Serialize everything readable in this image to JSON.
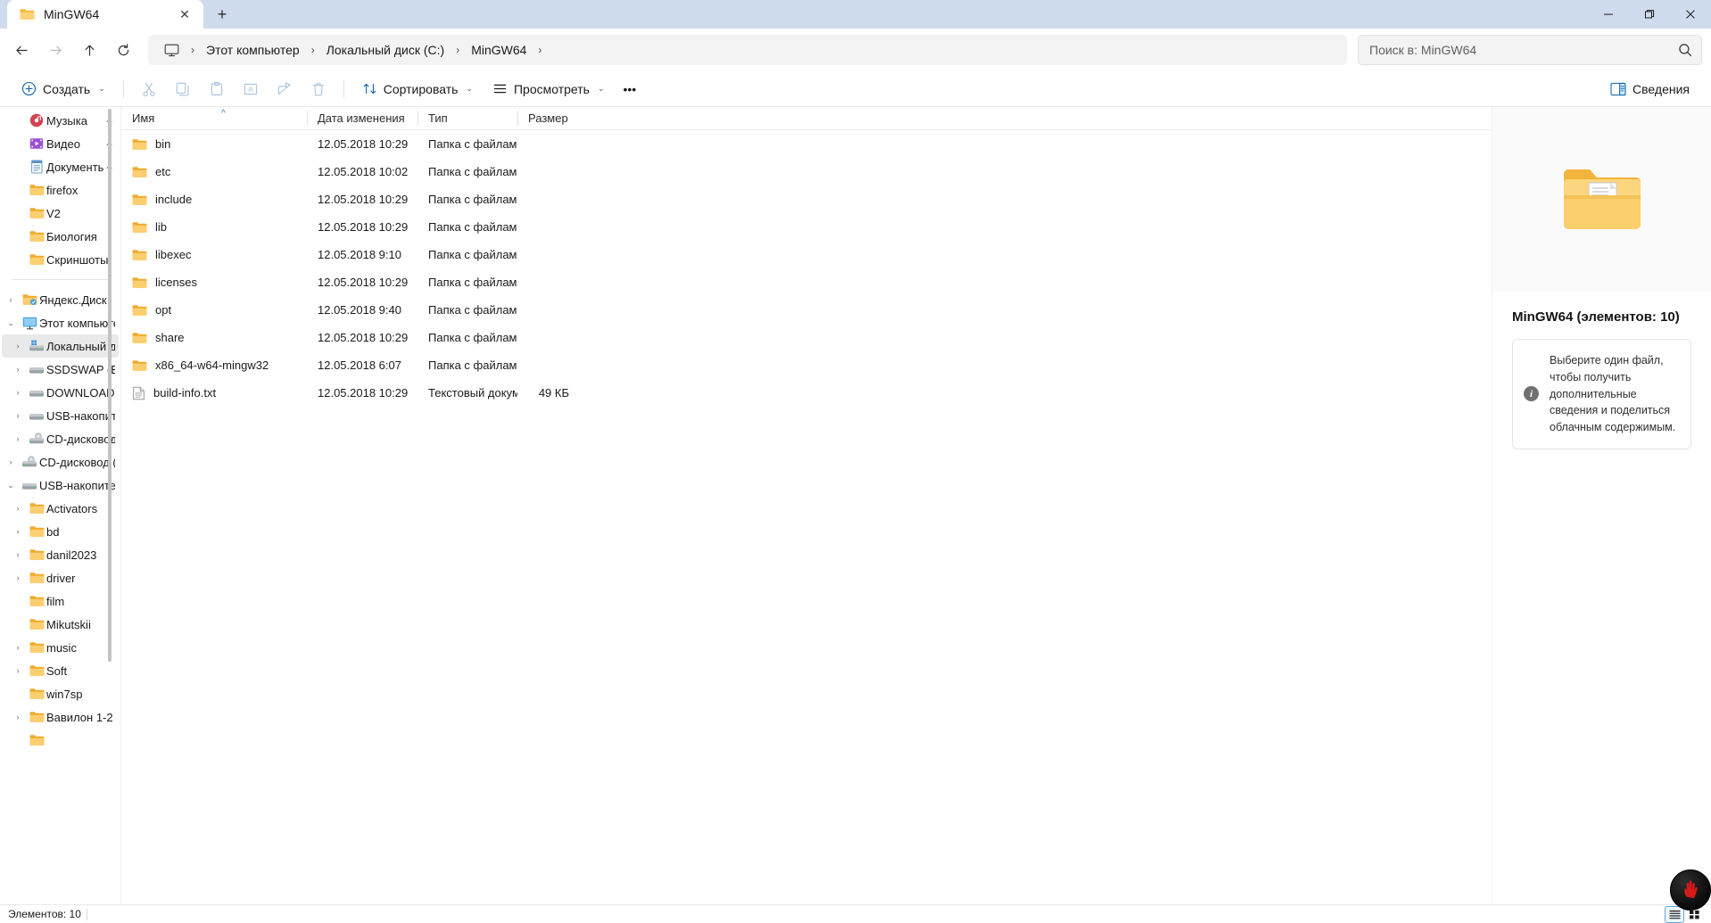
{
  "window": {
    "tab_title": "MinGW64",
    "tab_close_label": "✕",
    "new_tab_label": "+",
    "minimize_label": "—",
    "maximize_label": "❐",
    "close_label": "✕"
  },
  "nav": {
    "back_label": "←",
    "forward_label": "→",
    "up_label": "↑",
    "refresh_label": "⟳",
    "breadcrumbs": [
      {
        "label": "Этот компьютер"
      },
      {
        "label": "Локальный диск (C:)"
      },
      {
        "label": "MinGW64"
      }
    ],
    "separator": "›"
  },
  "search": {
    "placeholder": "Поиск в: MinGW64",
    "value": ""
  },
  "toolbar": {
    "new_label": "Создать",
    "cut_label": "",
    "copy_label": "",
    "paste_label": "",
    "rename_label": "",
    "share_label": "",
    "delete_label": "",
    "sort_label": "Сортировать",
    "view_label": "Просмотреть",
    "more_label": "•••",
    "details_label": "Сведения",
    "chevron": "⌄"
  },
  "sidebar": {
    "scroll_visible": true,
    "items": [
      {
        "label": "Музыка",
        "icon": "music-icon",
        "indent": 1,
        "twisty": "",
        "pinned": true
      },
      {
        "label": "Видео",
        "icon": "video-icon",
        "indent": 1,
        "twisty": "",
        "pinned": true
      },
      {
        "label": "Документы",
        "icon": "document-icon",
        "indent": 1,
        "twisty": "",
        "pinned": true
      },
      {
        "label": "firefox",
        "icon": "folder-icon",
        "indent": 1,
        "twisty": "",
        "pinned": false
      },
      {
        "label": "V2",
        "icon": "folder-icon",
        "indent": 1,
        "twisty": "",
        "pinned": false
      },
      {
        "label": "Биология",
        "icon": "folder-icon",
        "indent": 1,
        "twisty": "",
        "pinned": false
      },
      {
        "label": "Скриншоты",
        "icon": "folder-icon",
        "indent": 1,
        "twisty": "",
        "pinned": false
      },
      {
        "divider": true
      },
      {
        "label": "Яндекс.Диск",
        "icon": "yandex-disk-icon",
        "indent": 0,
        "twisty": "›",
        "pinned": false
      },
      {
        "label": "Этот компьютер",
        "icon": "computer-icon",
        "indent": 0,
        "twisty": "⌄",
        "pinned": false
      },
      {
        "label": "Локальный ди",
        "icon": "local-disk-icon",
        "indent": 1,
        "twisty": "›",
        "pinned": false,
        "selected": true
      },
      {
        "label": "SSDSWAP (E:)",
        "icon": "drive-icon",
        "indent": 1,
        "twisty": "›",
        "pinned": false
      },
      {
        "label": "DOWNLOADS",
        "icon": "drive-icon",
        "indent": 1,
        "twisty": "›",
        "pinned": false
      },
      {
        "label": "USB-накопите",
        "icon": "drive-icon",
        "indent": 1,
        "twisty": "›",
        "pinned": false
      },
      {
        "label": "CD-дисковод",
        "icon": "cd-drive-icon",
        "indent": 1,
        "twisty": "›",
        "pinned": false
      },
      {
        "label": "CD-дисковод (I:",
        "icon": "cd-drive-icon",
        "indent": 0,
        "twisty": "›",
        "pinned": false
      },
      {
        "label": "USB-накопител",
        "icon": "drive-icon",
        "indent": 0,
        "twisty": "⌄",
        "pinned": false
      },
      {
        "label": "Activators",
        "icon": "folder-icon",
        "indent": 1,
        "twisty": "›",
        "pinned": false
      },
      {
        "label": "bd",
        "icon": "folder-icon",
        "indent": 1,
        "twisty": "›",
        "pinned": false
      },
      {
        "label": "danil2023",
        "icon": "folder-icon",
        "indent": 1,
        "twisty": "›",
        "pinned": false
      },
      {
        "label": "driver",
        "icon": "folder-icon",
        "indent": 1,
        "twisty": "›",
        "pinned": false
      },
      {
        "label": "film",
        "icon": "folder-icon",
        "indent": 1,
        "twisty": "",
        "pinned": false
      },
      {
        "label": "Mikutskii",
        "icon": "folder-icon",
        "indent": 1,
        "twisty": "",
        "pinned": false
      },
      {
        "label": "music",
        "icon": "folder-icon",
        "indent": 1,
        "twisty": "›",
        "pinned": false
      },
      {
        "label": "Soft",
        "icon": "folder-icon",
        "indent": 1,
        "twisty": "›",
        "pinned": false
      },
      {
        "label": "win7sp",
        "icon": "folder-icon",
        "indent": 1,
        "twisty": "",
        "pinned": false
      },
      {
        "label": "Вавилон 1-2",
        "icon": "folder-icon",
        "indent": 1,
        "twisty": "›",
        "pinned": false
      },
      {
        "label": "",
        "icon": "folder-icon",
        "indent": 1,
        "twisty": "",
        "pinned": false
      }
    ]
  },
  "filelist": {
    "columns": [
      {
        "key": "name",
        "label": "Имя",
        "sorted": true,
        "sort_dir": "asc"
      },
      {
        "key": "date",
        "label": "Дата изменения"
      },
      {
        "key": "type",
        "label": "Тип"
      },
      {
        "key": "size",
        "label": "Размер"
      }
    ],
    "sort_glyph": "^",
    "rows": [
      {
        "name": "bin",
        "date": "12.05.2018 10:29",
        "type": "Папка с файлами",
        "size": "",
        "icon": "folder-icon"
      },
      {
        "name": "etc",
        "date": "12.05.2018 10:02",
        "type": "Папка с файлами",
        "size": "",
        "icon": "folder-icon"
      },
      {
        "name": "include",
        "date": "12.05.2018 10:29",
        "type": "Папка с файлами",
        "size": "",
        "icon": "folder-icon"
      },
      {
        "name": "lib",
        "date": "12.05.2018 10:29",
        "type": "Папка с файлами",
        "size": "",
        "icon": "folder-icon"
      },
      {
        "name": "libexec",
        "date": "12.05.2018 9:10",
        "type": "Папка с файлами",
        "size": "",
        "icon": "folder-icon"
      },
      {
        "name": "licenses",
        "date": "12.05.2018 10:29",
        "type": "Папка с файлами",
        "size": "",
        "icon": "folder-icon"
      },
      {
        "name": "opt",
        "date": "12.05.2018 9:40",
        "type": "Папка с файлами",
        "size": "",
        "icon": "folder-icon"
      },
      {
        "name": "share",
        "date": "12.05.2018 10:29",
        "type": "Папка с файлами",
        "size": "",
        "icon": "folder-icon"
      },
      {
        "name": "x86_64-w64-mingw32",
        "date": "12.05.2018 6:07",
        "type": "Папка с файлами",
        "size": "",
        "icon": "folder-icon"
      },
      {
        "name": "build-info.txt",
        "date": "12.05.2018 10:29",
        "type": "Текстовый докум...",
        "size": "49 КБ",
        "icon": "text-file-icon"
      }
    ]
  },
  "details": {
    "preview_icon": "folder-with-document-icon",
    "title": "MinGW64 (элементов: 10)",
    "info_text": "Выберите один файл, чтобы получить дополнительные сведения и поделиться облачным содержимым.",
    "info_icon": "info-icon"
  },
  "statusbar": {
    "items_text": "Элементов: 10",
    "details_view_icon": "details-view-icon",
    "large_icons_view_icon": "large-icons-view-icon"
  },
  "colors": {
    "titlebar_bg": "#cfdced",
    "folder_yellow": "#f7c86a",
    "folder_yellow_dark": "#e8a93a",
    "accent_blue": "#5aa9e6",
    "selection_gray": "#e9e9e9"
  }
}
